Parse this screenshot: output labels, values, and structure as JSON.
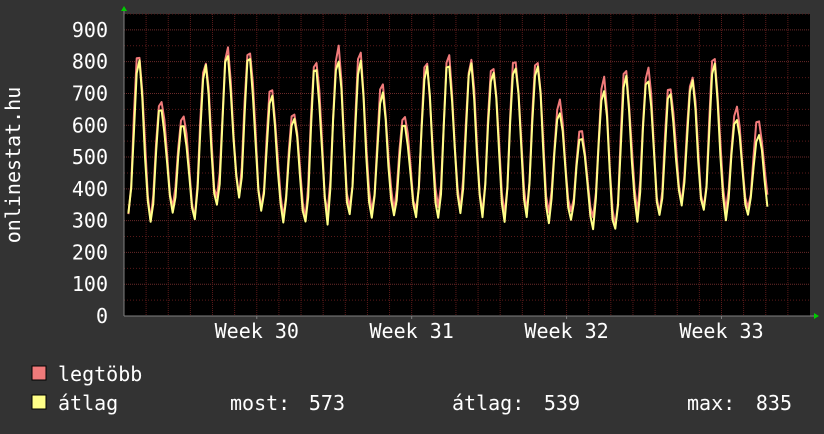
{
  "colors": {
    "background": "#333333",
    "plot_background": "#000000",
    "text": "#ffffff",
    "grid_minor": "#5a1a1a",
    "grid_major": "#6a2a2a",
    "axis": "#808080",
    "arrow": "#00cc00",
    "series_max": "#f07a7a",
    "series_avg": "#ffff88"
  },
  "chart_data": {
    "type": "line",
    "ylabel": "onlinestat.hu",
    "ylim": [
      0,
      950
    ],
    "yticks": [
      "0",
      "100",
      "200",
      "300",
      "400",
      "500",
      "600",
      "700",
      "800",
      "900"
    ],
    "xlim": [
      0,
      31
    ],
    "xticks": [
      {
        "label": "Week 30",
        "x": 6
      },
      {
        "label": "Week 31",
        "x": 13
      },
      {
        "label": "Week 32",
        "x": 20
      },
      {
        "label": "Week 33",
        "x": 27
      }
    ],
    "grid": true,
    "legend_placement": "bottom-left",
    "series": [
      {
        "name": "legtöbb",
        "color_key": "series_max",
        "peaks": [
          835,
          690,
          640,
          810,
          840,
          850,
          720,
          650,
          820,
          850,
          830,
          730,
          640,
          800,
          820,
          810,
          800,
          820,
          820,
          680,
          590,
          750,
          780,
          790,
          730,
          760,
          820,
          660,
          620
        ],
        "troughs": [
          330,
          310,
          350,
          320,
          360,
          390,
          340,
          320,
          320,
          320,
          330,
          320,
          340,
          330,
          330,
          330,
          340,
          330,
          340,
          320,
          330,
          300,
          280,
          330,
          330,
          360,
          340,
          330,
          340
        ]
      },
      {
        "name": "átlag",
        "color_key": "series_avg",
        "peaks": [
          800,
          660,
          610,
          790,
          820,
          820,
          690,
          630,
          790,
          820,
          800,
          700,
          610,
          790,
          800,
          790,
          780,
          800,
          800,
          650,
          570,
          720,
          750,
          760,
          700,
          740,
          790,
          630,
          573
        ],
        "troughs": [
          310,
          300,
          330,
          300,
          340,
          370,
          320,
          300,
          300,
          300,
          310,
          300,
          320,
          310,
          310,
          310,
          320,
          310,
          320,
          300,
          310,
          280,
          260,
          310,
          310,
          340,
          320,
          310,
          320
        ]
      }
    ]
  },
  "legend": {
    "items": [
      {
        "label": "legtöbb",
        "color_key": "series_max"
      },
      {
        "label": "átlag",
        "color_key": "series_avg"
      }
    ],
    "stats": [
      {
        "label": "most:",
        "value": "573"
      },
      {
        "label": "átlag:",
        "value": "539"
      },
      {
        "label": "max:",
        "value": "835"
      }
    ]
  }
}
